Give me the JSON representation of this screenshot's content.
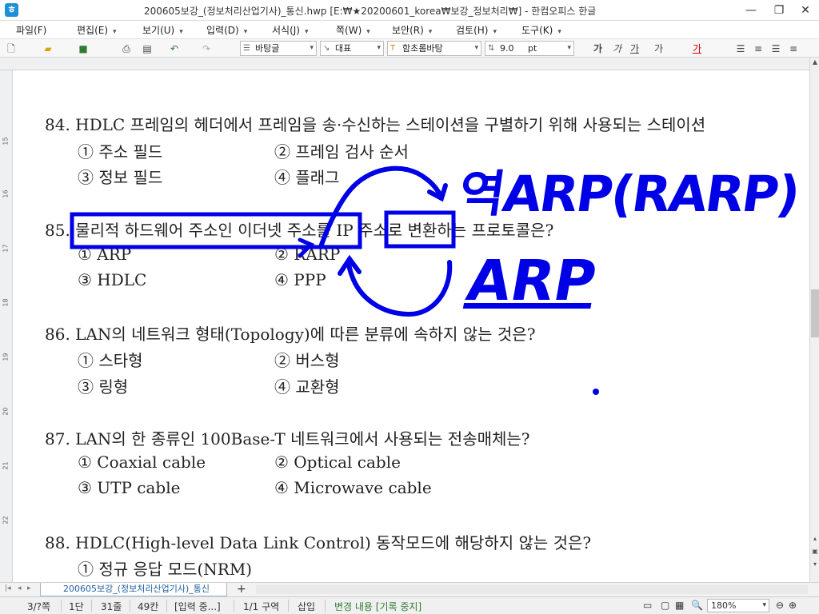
{
  "window": {
    "title": "200605보강_(정보처리산업기사)_통신.hwp [E:₩★20200601_korea₩보강_정보처리₩] - 한컴오피스 한글",
    "app_icon": "hwp-icon",
    "minimize": "—",
    "restore": "❐",
    "close": "✕"
  },
  "menu": {
    "items": [
      {
        "label": "파일(F)",
        "has_arrow": true
      },
      {
        "label": "편집(E)",
        "has_arrow": true
      },
      {
        "label": "보기(U)",
        "has_arrow": true
      },
      {
        "label": "입력(D)",
        "has_arrow": true
      },
      {
        "label": "서식(J)",
        "has_arrow": true
      },
      {
        "label": "쪽(W)",
        "has_arrow": true
      },
      {
        "label": "보안(R)",
        "has_arrow": true
      },
      {
        "label": "검토(H)",
        "has_arrow": true
      },
      {
        "label": "도구(K)",
        "has_arrow": true
      }
    ],
    "search_value": "보안"
  },
  "toolbar": {
    "style_combo": "바탕글",
    "lang_combo": "대표",
    "font_combo": "함초롬바탕",
    "size_combo": "9.0",
    "size_unit": "pt",
    "format_buttons": [
      "가",
      "가",
      "가",
      "가",
      "가"
    ]
  },
  "ruler": {
    "numbers": [
      "15",
      "16",
      "17",
      "18",
      "19",
      "20",
      "21",
      "22"
    ]
  },
  "document": {
    "lines": [
      "84. HDLC 프레임의 헤더에서 프레임을 송·수신하는 스테이션을 구별하기 위해 사용되는 스테이션",
      "① 주소 필드",
      "② 프레임 검사 순서",
      "③ 정보 필드",
      "④ 플래그",
      "85. 물리적 하드웨어 주소인 이더넷 주소를 IP 주소로 변환하는 프로토콜은?",
      "① ARP",
      "② RARP",
      "③ HDLC",
      "④ PPP",
      "86. LAN의 네트워크 형태(Topology)에 따른 분류에 속하지 않는 것은?",
      "① 스타형",
      "② 버스형",
      "③ 링형",
      "④ 교환형",
      "87. LAN의 한 종류인 100Base-T 네트워크에서 사용되는 전송매체는?",
      "① Coaxial cable",
      "② Optical cable",
      "③ UTP cable",
      "④ Microwave cable",
      "88. HDLC(High-level Data Link Control) 동작모드에 해당하지 않는 것은?",
      "① 정규 응답 모드(NRM)"
    ],
    "annotations": {
      "pen_color": "#0000e6",
      "text_top": "역ARP(RARP)",
      "text_bottom": "ARP"
    }
  },
  "tabs": {
    "active": "200605보강_(정보처리산업기사)_통신",
    "add": "+"
  },
  "status": {
    "page": "3/?쪽",
    "column": "1단",
    "line": "31줄",
    "char": "49칸",
    "input": "[입력 중...]",
    "section": "1/1 구역",
    "mode": "삽입",
    "track": "변경 내용 [기록 중지]",
    "zoom": "180%"
  }
}
